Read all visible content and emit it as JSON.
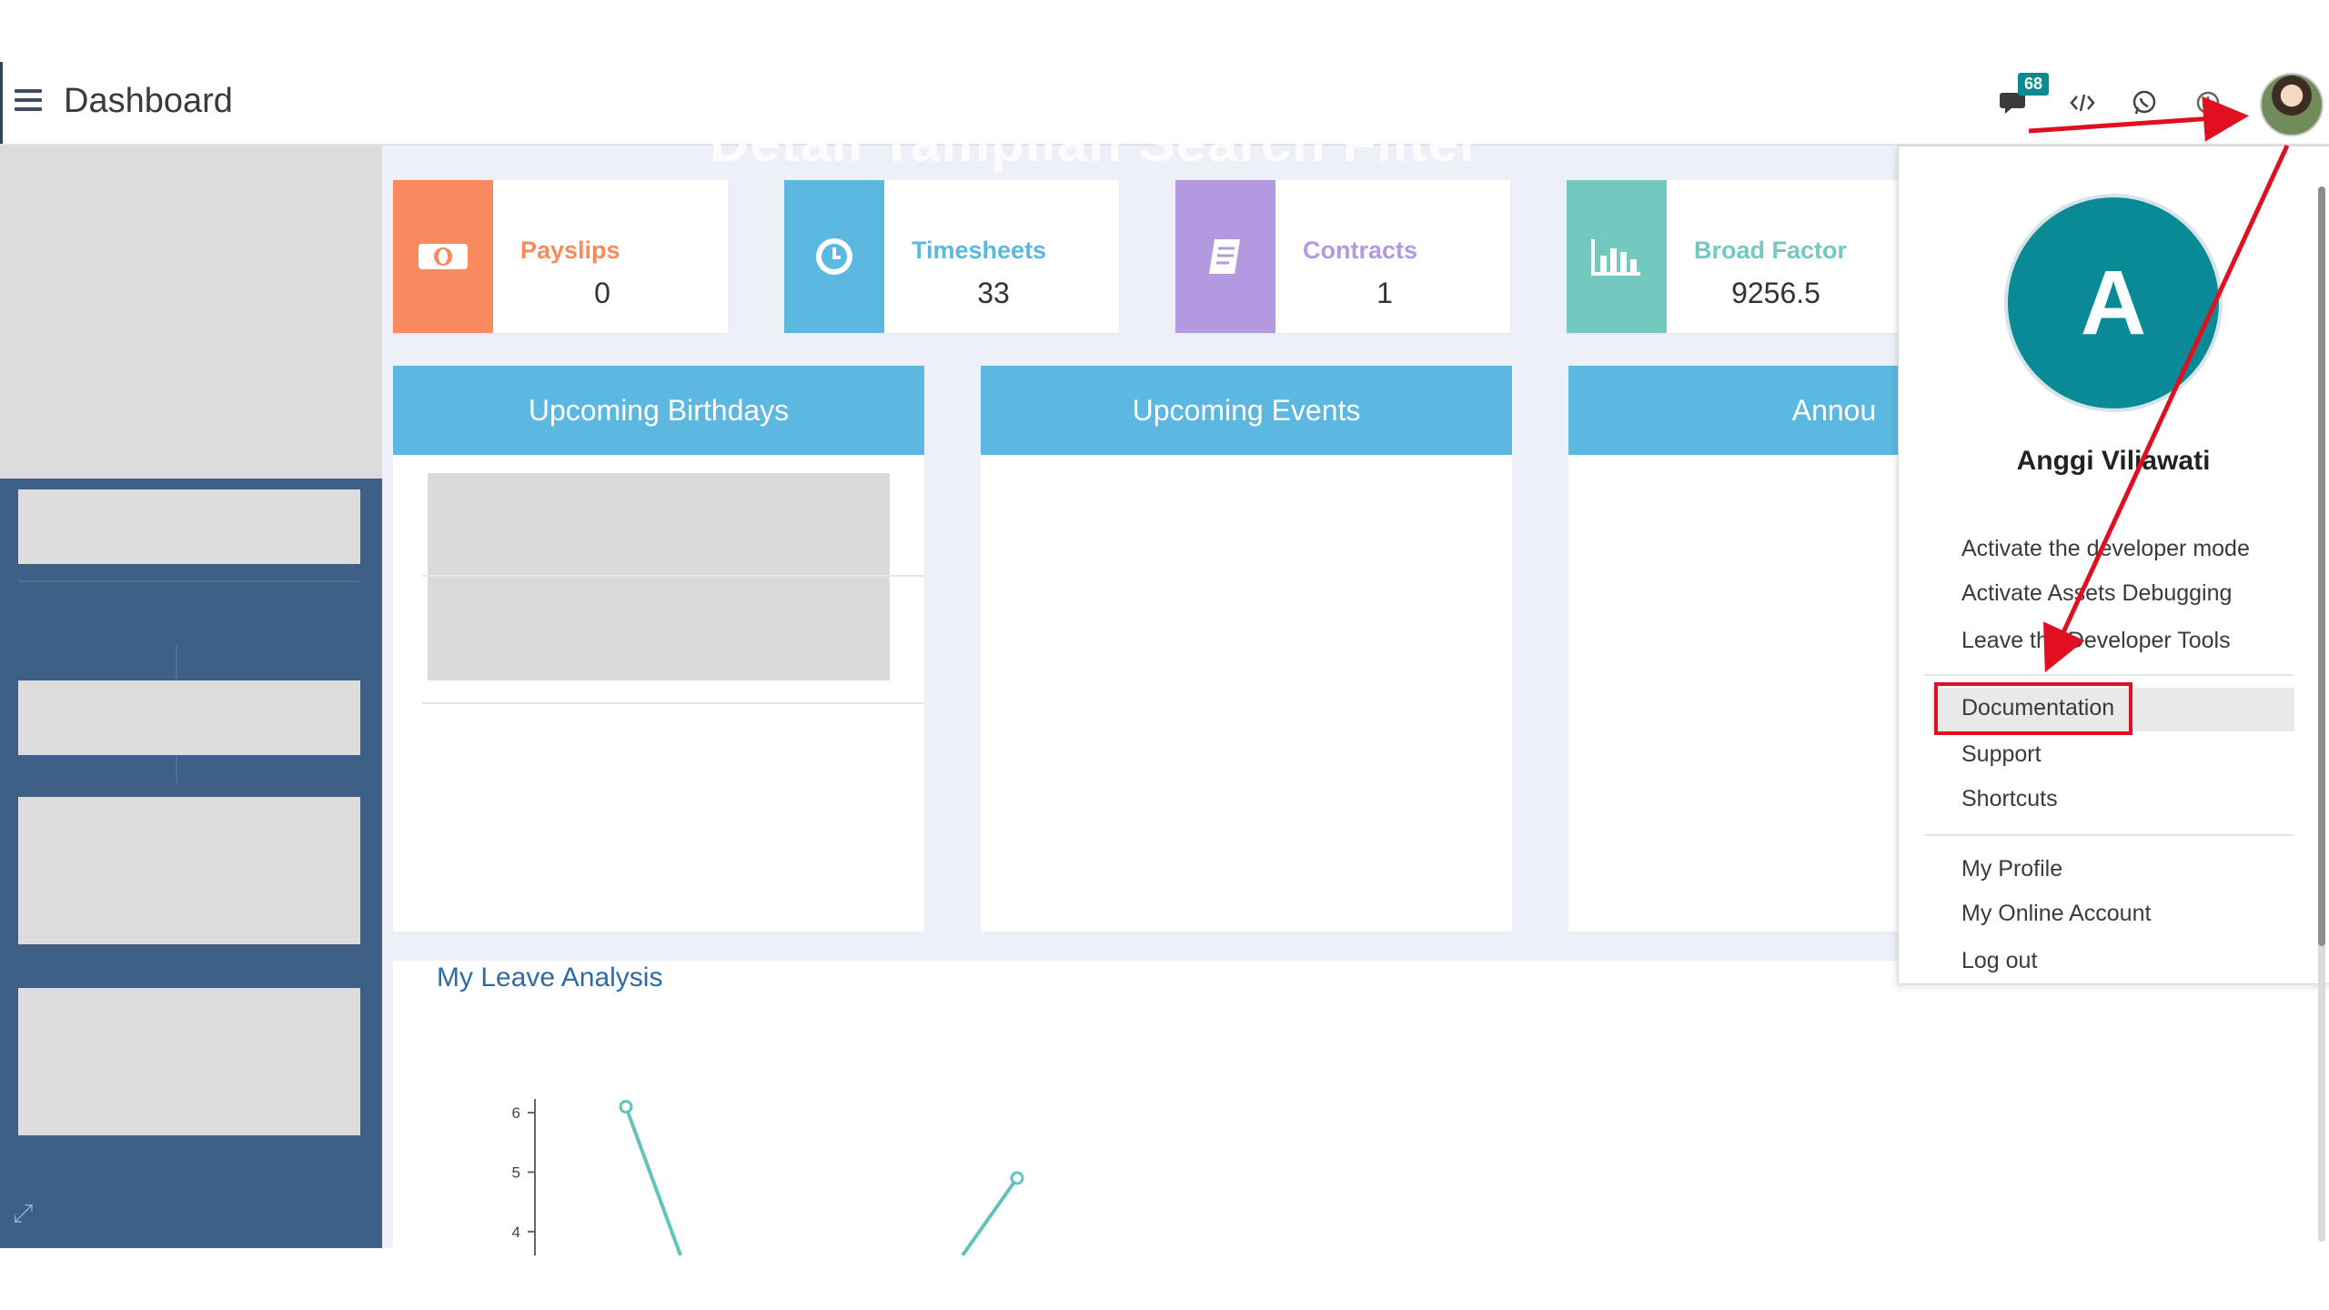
{
  "header": {
    "title": "Dashboard",
    "messages_badge": "68",
    "icons": [
      "chat-icon",
      "code-icon",
      "whatsapp-icon",
      "clock-icon",
      "avatar"
    ]
  },
  "watermark": "Detail Tampilan Search Filter",
  "stats": [
    {
      "label": "Payslips",
      "value": "0",
      "color": "#f98a5e",
      "icon": "money-icon"
    },
    {
      "label": "Timesheets",
      "value": "33",
      "color": "#5bb8e1",
      "icon": "clock-icon"
    },
    {
      "label": "Contracts",
      "value": "1",
      "color": "#b399e0",
      "icon": "document-icon"
    },
    {
      "label": "Broad Factor",
      "value": "9256.5",
      "color": "#73c9c0",
      "icon": "bar-chart-icon"
    }
  ],
  "panels": [
    {
      "title": "Upcoming Birthdays"
    },
    {
      "title": "Upcoming Events"
    },
    {
      "title": "Annou"
    }
  ],
  "leave_section": {
    "title": "My Leave Analysis"
  },
  "chart_data": {
    "type": "line",
    "title": "",
    "xlabel": "",
    "ylabel": "",
    "y_ticks": [
      "6",
      "5",
      "4"
    ],
    "series": [
      {
        "points": [
          [
            1,
            6.1
          ],
          [
            1.6,
            3.6
          ]
        ]
      },
      {
        "points": [
          [
            5.3,
            4.9
          ],
          [
            4.7,
            3.6
          ]
        ]
      }
    ],
    "ylim": [
      3.6,
      6.2
    ],
    "line_color": "#62c3bb"
  },
  "user_menu": {
    "avatar_letter": "A",
    "name": "Anggi Viliawati",
    "developer_items": [
      "Activate the developer mode",
      "Activate Assets Debugging",
      "Leave the Developer Tools"
    ],
    "help_items": [
      "Documentation",
      "Support",
      "Shortcuts"
    ],
    "account_items": [
      "My Profile",
      "My Online Account",
      "Log out"
    ],
    "highlighted": "Documentation"
  },
  "colors": {
    "sidebar": "#3e5f86",
    "panel_header": "#5cb8e0",
    "accent_red": "#e01020"
  }
}
